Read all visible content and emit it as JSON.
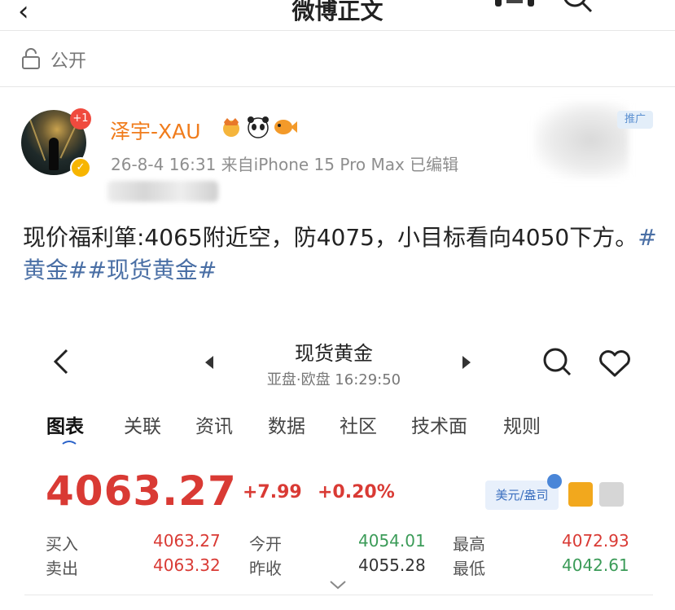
{
  "nav": {
    "title": "微博正文"
  },
  "visibility": {
    "label": "公开"
  },
  "post": {
    "avatar_badge": "+1",
    "username": "泽宇-XAU",
    "meta": "26-8-4 16:31  来自iPhone 15 Pro Max  已编辑",
    "promo_tag": "推广",
    "body_text": "现价福利箪:4065附近空，防4075，小目标看向4050下方。",
    "hashtags": [
      "#黄金#",
      "#现货黄金#"
    ]
  },
  "embed": {
    "title": "现货黄金",
    "subtitle": "亚盘·欧盘 16:29:50",
    "tabs": [
      "图表",
      "关联",
      "资讯",
      "数据",
      "社区",
      "技术面",
      "规则"
    ],
    "active_tab": "图表",
    "price": "4063.27",
    "change": "+7.99",
    "change_pct": "+0.20%",
    "currency_chip": "美元/盎司",
    "quotes": {
      "buy_label": "买入",
      "buy_value": "4063.27",
      "sell_label": "卖出",
      "sell_value": "4063.32",
      "open_label": "今开",
      "open_value": "4054.01",
      "prev_close_label": "昨收",
      "prev_close_value": "4055.28",
      "high_label": "最高",
      "high_value": "4072.93",
      "low_label": "最低",
      "low_value": "4042.61"
    }
  },
  "colors": {
    "username": "#f07c1c",
    "hashtag": "#4a6fa5",
    "price_up": "#d93a34",
    "quote_green": "#3b9b58"
  }
}
